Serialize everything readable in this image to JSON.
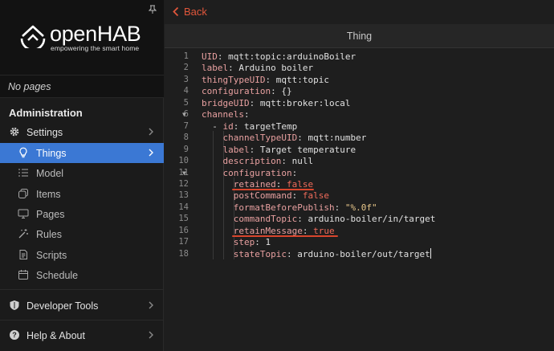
{
  "sidebar": {
    "logo": {
      "title": "openHAB",
      "subtitle": "empowering the smart home"
    },
    "no_pages": "No pages",
    "section": "Administration",
    "items": [
      {
        "label": "Settings",
        "icon": "gear-icon"
      },
      {
        "label": "Things",
        "icon": "lightbulb-icon",
        "active": true
      },
      {
        "label": "Model",
        "icon": "list-icon"
      },
      {
        "label": "Items",
        "icon": "items-icon"
      },
      {
        "label": "Pages",
        "icon": "display-icon"
      },
      {
        "label": "Rules",
        "icon": "wand-icon"
      },
      {
        "label": "Scripts",
        "icon": "script-icon"
      },
      {
        "label": "Schedule",
        "icon": "calendar-icon"
      },
      {
        "label": "Developer Tools",
        "icon": "shield-icon"
      },
      {
        "label": "Help & About",
        "icon": "help-icon"
      }
    ]
  },
  "topbar": {
    "back_label": "Back"
  },
  "subnav": {
    "title": "Thing"
  },
  "editor": {
    "lines": [
      "UID: mqtt:topic:arduinoBoiler",
      "label: Arduino boiler",
      "thingTypeUID: mqtt:topic",
      "configuration: {}",
      "bridgeUID: mqtt:broker:local",
      "channels:",
      "  - id: targetTemp",
      "    channelTypeUID: mqtt:number",
      "    label: Target temperature",
      "    description: null",
      "    configuration:",
      "      retained: false",
      "      postCommand: false",
      "      formatBeforePublish: \"%.0f\"",
      "      commandTopic: arduino-boiler/in/target",
      "      retainMessage: true",
      "      step: 1",
      "      stateTopic: arduino-boiler/out/target"
    ],
    "line_numbers": [
      "1",
      "2",
      "3",
      "4",
      "5",
      "6",
      "7",
      "8",
      "9",
      "10",
      "11",
      "12",
      "13",
      "14",
      "15",
      "16",
      "17",
      "18"
    ],
    "highlight_color": "#d8452c"
  },
  "colors": {
    "accent": "#3b78d4",
    "back": "#e0563b"
  }
}
